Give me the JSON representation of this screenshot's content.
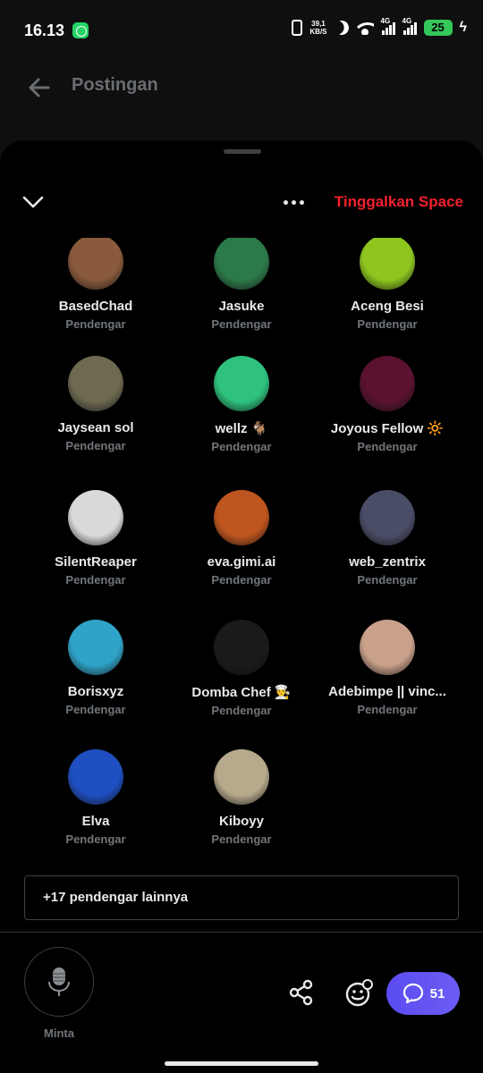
{
  "status_bar": {
    "time": "16.13",
    "net_speed_value": "39,1",
    "net_speed_unit": "KB/S",
    "sim1": "4G",
    "sim2": "4G",
    "battery": "25"
  },
  "header": {
    "title": "Postingan"
  },
  "sheet": {
    "leave_label": "Tinggalkan Space"
  },
  "listeners": [
    {
      "name": "BasedChad",
      "role": "Pendengar",
      "avatar_color": "#8a5a3c",
      "avatar_icon": "portrait-avatar"
    },
    {
      "name": "Jasuke",
      "role": "Pendengar",
      "avatar_color": "#2c7a4a",
      "avatar_icon": "portrait-avatar"
    },
    {
      "name": "Aceng Besi",
      "role": "Pendengar",
      "avatar_color": "#8ec61f",
      "avatar_icon": "frog-avatar"
    },
    {
      "name": "Jaysean sol",
      "role": "Pendengar",
      "avatar_color": "#6e6a52",
      "avatar_icon": "dog-avatar"
    },
    {
      "name": "wellz 🐐",
      "role": "Pendengar",
      "avatar_color": "#2ec27e",
      "avatar_icon": "logo-avatar"
    },
    {
      "name": "Joyous Fellow 🔆",
      "role": "Pendengar",
      "avatar_color": "#5a1230",
      "avatar_icon": "pattern-avatar"
    },
    {
      "name": "SilentReaper",
      "role": "Pendengar",
      "avatar_color": "#d9d9d9",
      "avatar_icon": "anime-avatar"
    },
    {
      "name": "eva.gimi.ai",
      "role": "Pendengar",
      "avatar_color": "#c0561f",
      "avatar_icon": "portrait-avatar"
    },
    {
      "name": "web_zentrix",
      "role": "Pendengar",
      "avatar_color": "#4a4d66",
      "avatar_icon": "hat-avatar"
    },
    {
      "name": "Borisxyz",
      "role": "Pendengar",
      "avatar_color": "#2fa3c8",
      "avatar_icon": "cartoon-avatar"
    },
    {
      "name": "Domba Chef 👨‍🍳",
      "role": "Pendengar",
      "avatar_color": "#1a1a1a",
      "avatar_icon": "figure-avatar"
    },
    {
      "name": "Adebimpe || vinc...",
      "role": "Pendengar",
      "avatar_color": "#c9a08a",
      "avatar_icon": "hamster-avatar"
    },
    {
      "name": "Elva",
      "role": "Pendengar",
      "avatar_color": "#1f4fc2",
      "avatar_icon": "hedgehog-avatar"
    },
    {
      "name": "Kiboyy",
      "role": "Pendengar",
      "avatar_color": "#b7aa8c",
      "avatar_icon": "puppies-avatar"
    }
  ],
  "more_listeners_label": "+17 pendengar lainnya",
  "bottom_bar": {
    "request_label": "Minta",
    "chat_count": "51"
  },
  "colors": {
    "leave_red": "#f4212e",
    "chat_purple": "#5a4cf0",
    "muted_text": "#71767b"
  }
}
